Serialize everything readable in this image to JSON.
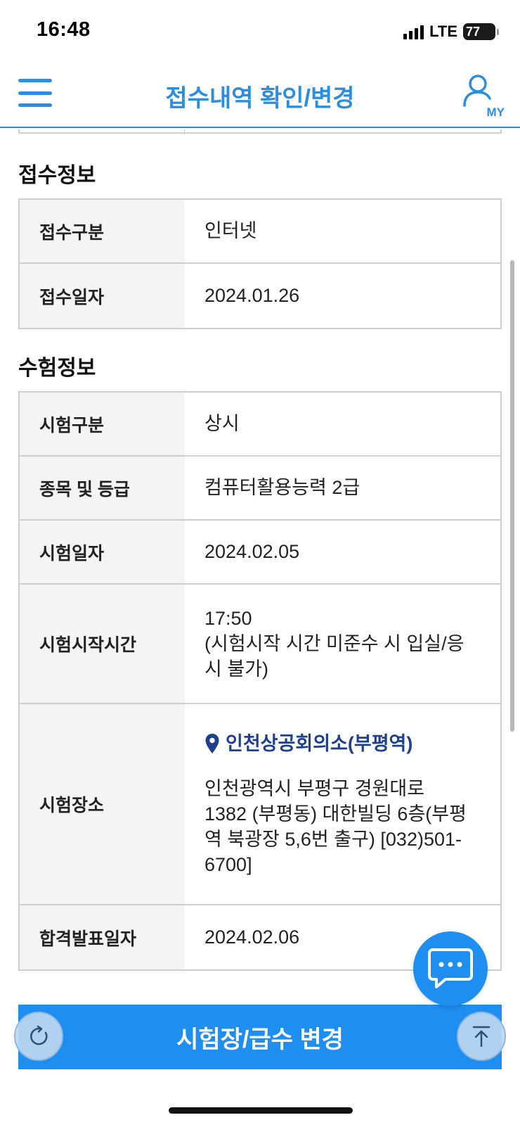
{
  "status_bar": {
    "time": "16:48",
    "network": "LTE",
    "battery_level": "77",
    "battery_percent": 77
  },
  "header": {
    "title": "접수내역 확인/변경",
    "menu_icon": "hamburger-menu-icon",
    "my_icon": "user-icon",
    "my_label": "MY"
  },
  "reception": {
    "section_title": "접수정보",
    "rows": [
      {
        "label": "접수구분",
        "value": "인터넷"
      },
      {
        "label": "접수일자",
        "value": "2024.01.26"
      }
    ]
  },
  "exam": {
    "section_title": "수험정보",
    "type": {
      "label": "시험구분",
      "value": "상시"
    },
    "grade": {
      "label": "종목 및 등급",
      "value": "컴퓨터활용능력 2급"
    },
    "date": {
      "label": "시험일자",
      "value": "2024.02.05"
    },
    "start_time": {
      "label": "시험시작시간",
      "time": "17:50",
      "note_line1": "(시험시작 시간 미준수 시 입실/응",
      "note_line2": "시 불가)"
    },
    "venue": {
      "label": "시험장소",
      "name": "인천상공회의소(부평역)",
      "address_lines": [
        "인천광역시 부평구 경원대로",
        "1382 (부평동) 대한빌딩 6층(부평",
        "역 북광장 5,6번 출구) [032)501-",
        "6700]"
      ]
    },
    "result_date": {
      "label": "합격발표일자",
      "value": "2024.02.06"
    }
  },
  "actions": {
    "change_label": "시험장/급수 변경"
  },
  "icons": {
    "chat": "chat-bubble-icon",
    "refresh": "refresh-icon",
    "scroll_top": "scroll-to-top-icon",
    "location": "location-pin-icon"
  },
  "colors": {
    "brand": "#2b8ee0",
    "button": "#1f8ef1",
    "link": "#1f3f8f"
  }
}
